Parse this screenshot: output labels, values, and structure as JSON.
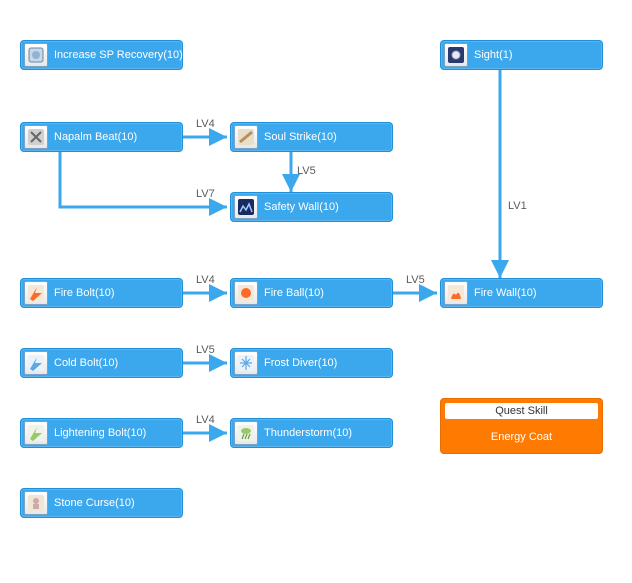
{
  "skills": {
    "increase_sp": {
      "label": "Increase SP Recovery(10)"
    },
    "napalm_beat": {
      "label": "Napalm Beat(10)"
    },
    "soul_strike": {
      "label": "Soul Strike(10)"
    },
    "safety_wall": {
      "label": "Safety Wall(10)"
    },
    "sight": {
      "label": "Sight(1)"
    },
    "fire_bolt": {
      "label": "Fire Bolt(10)"
    },
    "fire_ball": {
      "label": "Fire Ball(10)"
    },
    "fire_wall": {
      "label": "Fire Wall(10)"
    },
    "cold_bolt": {
      "label": "Cold Bolt(10)"
    },
    "frost_diver": {
      "label": "Frost Diver(10)"
    },
    "lightening_bolt": {
      "label": "Lightening Bolt(10)"
    },
    "thunderstorm": {
      "label": "Thunderstorm(10)"
    },
    "stone_curse": {
      "label": "Stone Curse(10)"
    }
  },
  "levels": {
    "napalm_to_soul": "LV4",
    "soul_to_safety": "LV5",
    "napalm_to_safety": "LV7",
    "sight_to_firewall": "LV1",
    "firebolt_to_fireball": "LV4",
    "fireball_to_firewall": "LV5",
    "coldbolt_to_frostdiver": "LV5",
    "lightening_to_thunder": "LV4"
  },
  "quest": {
    "title": "Quest Skill",
    "skill": "Energy Coat"
  },
  "colors": {
    "node": "#3ba8ee",
    "arrow": "#3ba8ee",
    "quest": "#ff7a00"
  }
}
